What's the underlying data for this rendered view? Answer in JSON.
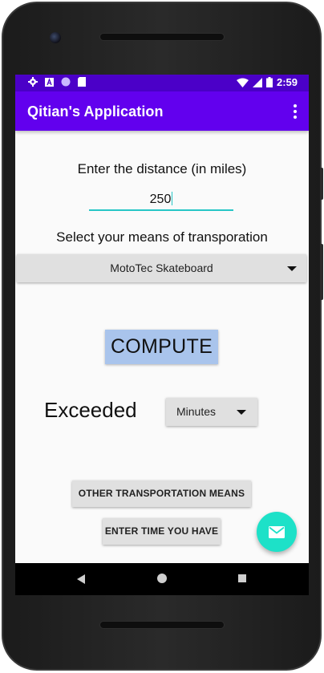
{
  "status_bar": {
    "time": "2:59",
    "left_icons": [
      "gear-icon",
      "a-letter-icon",
      "circle-icon",
      "sd-card-icon"
    ],
    "right_icons": [
      "wifi-icon",
      "signal-icon",
      "battery-icon"
    ]
  },
  "app_bar": {
    "title": "Qitian's Application"
  },
  "form": {
    "distance_label": "Enter the distance (in miles)",
    "distance_value": "250",
    "transport_label": "Select your means of transporation",
    "transport_selected": "MotoTec Skateboard",
    "compute_label": "COMPUTE",
    "result_text": "Exceeded",
    "unit_selected": "Minutes",
    "other_means_label": "OTHER TRANSPORTATION MEANS",
    "enter_time_label": "ENTER TIME YOU HAVE"
  },
  "colors": {
    "status_bar": "#4b00c8",
    "app_bar": "#6200ee",
    "compute_button": "#a9c4ec",
    "fab": "#1de1c8",
    "input_underline": "#26c6c6"
  }
}
